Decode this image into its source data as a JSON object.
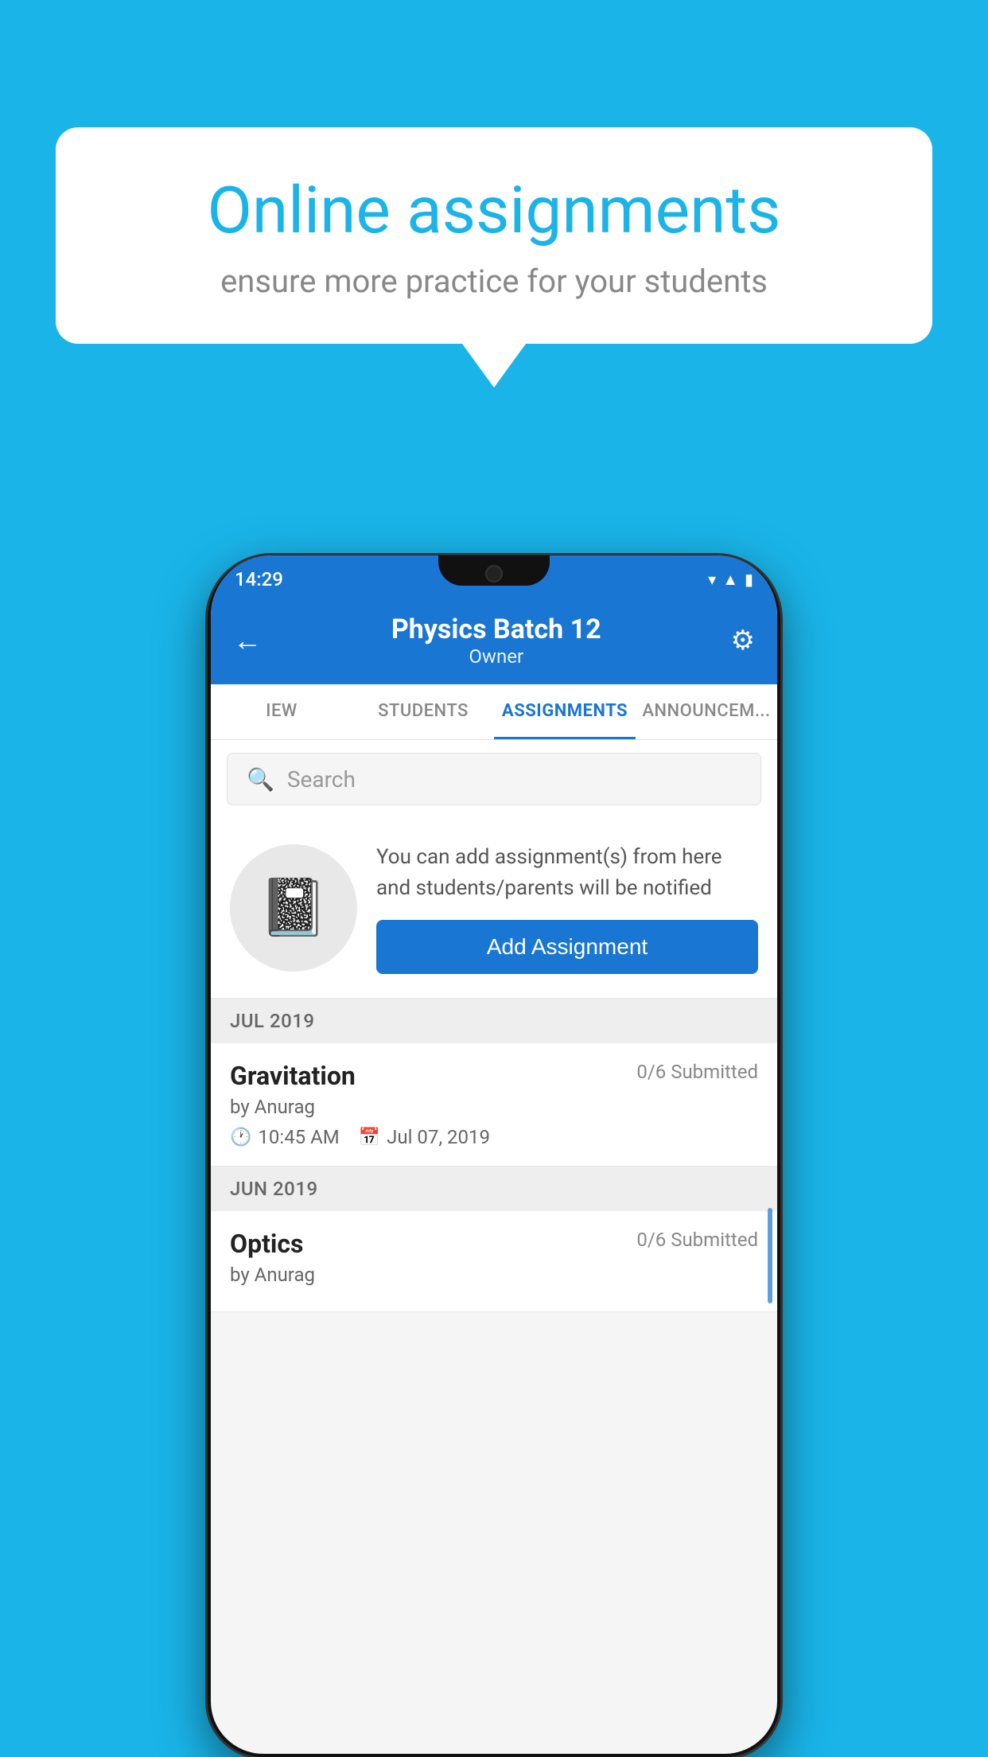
{
  "background_color": "#1ab4e8",
  "speech_bubble": {
    "title": "Online assignments",
    "subtitle": "ensure more practice for your students"
  },
  "phone": {
    "status_bar": {
      "time": "14:29",
      "icons": [
        "wifi",
        "signal",
        "battery"
      ]
    },
    "header": {
      "title": "Physics Batch 12",
      "subtitle": "Owner",
      "back_label": "←",
      "settings_label": "⚙"
    },
    "tabs": [
      {
        "label": "IEW",
        "active": false
      },
      {
        "label": "STUDENTS",
        "active": false
      },
      {
        "label": "ASSIGNMENTS",
        "active": true
      },
      {
        "label": "ANNOUNCEM...",
        "active": false
      }
    ],
    "search": {
      "placeholder": "Search"
    },
    "promo": {
      "text": "You can add assignment(s) from here and students/parents will be notified",
      "button_label": "Add Assignment"
    },
    "assignments": [
      {
        "month": "JUL 2019",
        "items": [
          {
            "name": "Gravitation",
            "submitted": "0/6 Submitted",
            "author": "by Anurag",
            "time": "10:45 AM",
            "date": "Jul 07, 2019"
          }
        ]
      },
      {
        "month": "JUN 2019",
        "items": [
          {
            "name": "Optics",
            "submitted": "0/6 Submitted",
            "author": "by Anurag",
            "time": "",
            "date": ""
          }
        ]
      }
    ]
  }
}
